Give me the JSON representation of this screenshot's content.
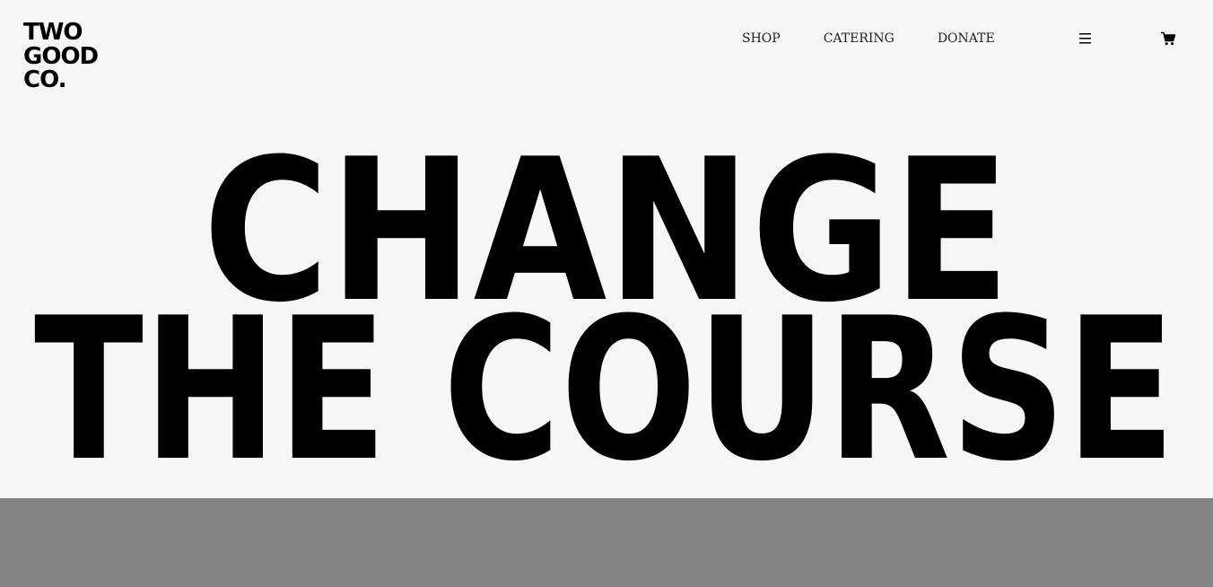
{
  "brand": {
    "logo_lines": [
      "TWO",
      "GOOD",
      "CO."
    ]
  },
  "nav": {
    "items": [
      {
        "label": "SHOP"
      },
      {
        "label": "CATERING"
      },
      {
        "label": "DONATE"
      }
    ]
  },
  "icons": {
    "menu": "hamburger-menu-icon",
    "cart": "shopping-cart-icon"
  },
  "hero": {
    "line1": "CHANGE",
    "line2": "THE COURSE"
  },
  "colors": {
    "background": "#f6f6f6",
    "text": "#000000",
    "band": "#838383"
  }
}
